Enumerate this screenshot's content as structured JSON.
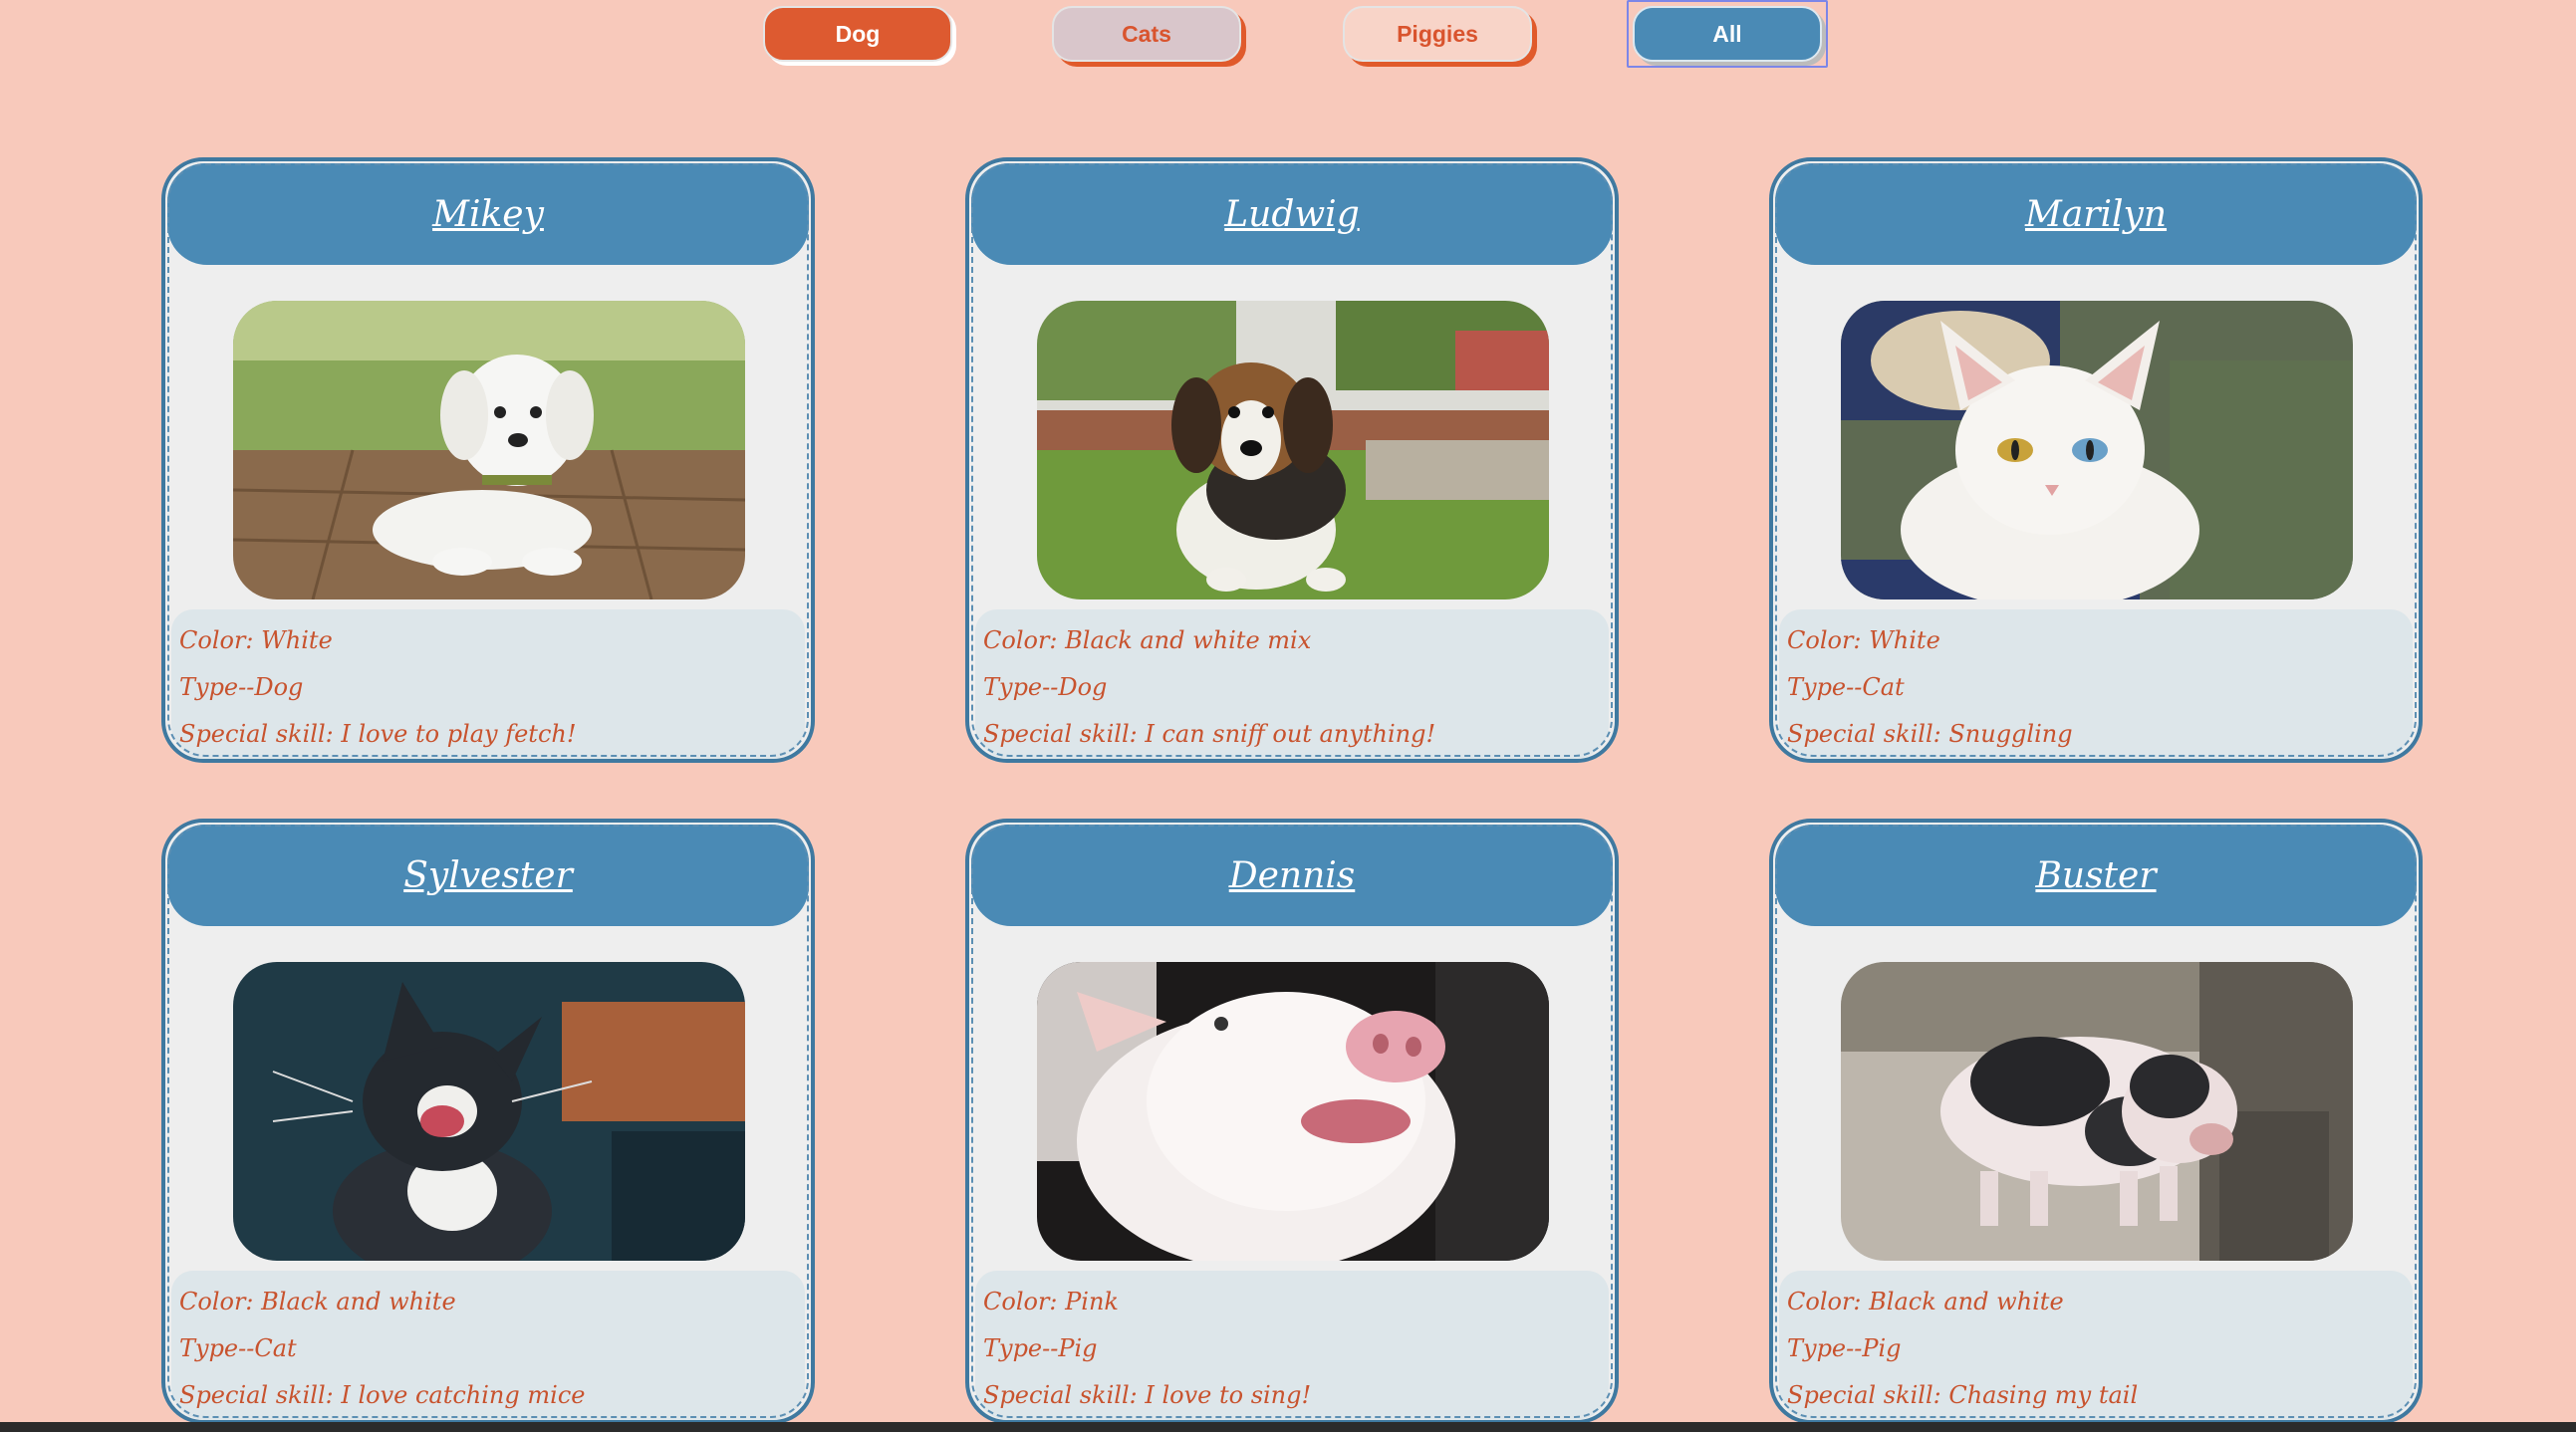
{
  "filters": {
    "dog": "Dog",
    "cats": "Cats",
    "piggies": "Piggies",
    "all": "All"
  },
  "pets": [
    {
      "name": "Mikey",
      "color": "Color: White",
      "type": "Type--Dog",
      "skill": "Special skill: I love to play fetch!",
      "photo": "white-puppy"
    },
    {
      "name": "Ludwig",
      "color": "Color: Black and white mix",
      "type": "Type--Dog",
      "skill": "Special skill: I can sniff out anything!",
      "photo": "beagle-puppy"
    },
    {
      "name": "Marilyn",
      "color": "Color: White",
      "type": "Type--Cat",
      "skill": "Special skill: Snuggling",
      "photo": "white-cat"
    },
    {
      "name": "Sylvester",
      "color": "Color: Black and white",
      "type": "Type--Cat",
      "skill": "Special skill: I love catching mice",
      "photo": "black-white-kitten"
    },
    {
      "name": "Dennis",
      "color": "Color: Pink",
      "type": "Type--Pig",
      "skill": "Special skill: I love to sing!",
      "photo": "pink-piglet"
    },
    {
      "name": "Buster",
      "color": "Color: Black and white",
      "type": "Type--Pig",
      "skill": "Special skill: Chasing my tail",
      "photo": "spotted-piglet"
    }
  ],
  "colors": {
    "page_bg": "#f8c9bb",
    "card_header": "#4a8ab5",
    "card_border": "#3f79a0",
    "info_text": "#c8532e",
    "dog_button": "#dd5a30"
  }
}
